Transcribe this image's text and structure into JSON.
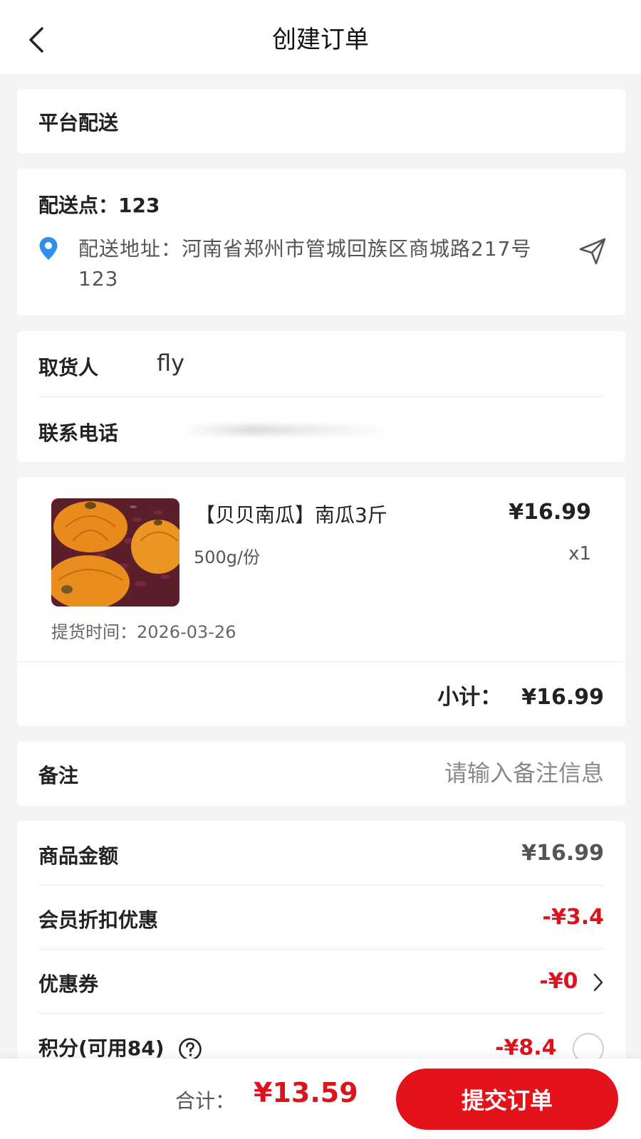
{
  "header": {
    "title": "创建订单"
  },
  "delivery": {
    "mode": "平台配送"
  },
  "address": {
    "point_label": "配送点：",
    "point_value": "123",
    "address_text": "配送地址：河南省郑州市管城回族区商城路217号123"
  },
  "contact": {
    "picker_label": "取货人",
    "picker_value": "fly",
    "phone_label": "联系电话"
  },
  "product": {
    "name": "【贝贝南瓜】南瓜3斤",
    "price": "¥16.99",
    "spec": "500g/份",
    "qty": "x1",
    "pickup_time": "提货时间：2026-03-26",
    "subtotal_label": "小计：",
    "subtotal_value": "¥16.99"
  },
  "remark": {
    "label": "备注",
    "placeholder": "请输入备注信息"
  },
  "summary": {
    "goods_label": "商品金额",
    "goods_value": "¥16.99",
    "member_label": "会员折扣优惠",
    "member_value": "-¥3.4",
    "coupon_label": "优惠券",
    "coupon_value": "-¥0",
    "points_label": "积分(可用84)",
    "points_value": "-¥8.4"
  },
  "footer": {
    "total_label": "合计：",
    "total_value": "¥13.59",
    "submit_label": "提交订单"
  },
  "colors": {
    "accent": "#e3121b",
    "discount_red": "#d9141f",
    "pin_blue": "#2f8fe9"
  },
  "icons": [
    "chevron-left-icon",
    "location-pin-icon",
    "send-icon",
    "chevron-right-icon",
    "help-circle-icon",
    "radio-circle-icon"
  ]
}
